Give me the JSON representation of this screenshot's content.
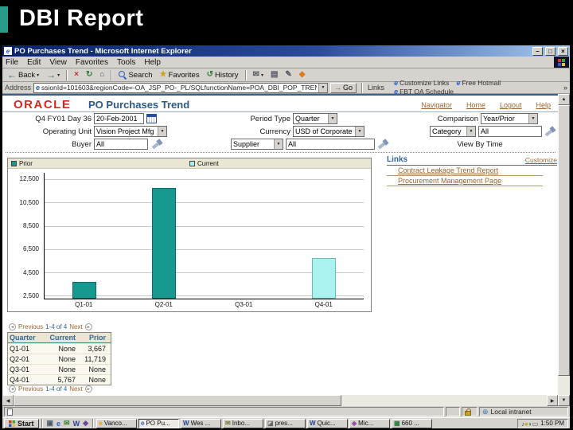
{
  "slide": {
    "title": "DBI Report",
    "accent_color": "#2a9a8a"
  },
  "browser": {
    "title": "PO Purchases Trend - Microsoft Internet Explorer",
    "menu_items": [
      "File",
      "Edit",
      "View",
      "Favorites",
      "Tools",
      "Help"
    ],
    "toolbar": {
      "back": "Back",
      "search": "Search",
      "favorites": "Favorites",
      "history": "History"
    },
    "address": {
      "label": "Address",
      "url": "ssionId=101603&regionCode=-OA_JSP_PO-_PL/SQLfunctionName=POA_DBI_POP_TREND_RP",
      "go": "Go"
    },
    "links_bar": {
      "label": "Links",
      "items": [
        "Customize Links",
        "Free Hotmail",
        "FBT QA Schedule"
      ],
      "overflow": "»"
    }
  },
  "page": {
    "brand": "ORACLE",
    "title": "PO Purchases Trend",
    "nav_links": [
      "Navigator",
      "Home",
      "Logout",
      "Help"
    ],
    "filters": {
      "date_label": "Q4 FY01 Day 36",
      "date_value": "20-Feb-2001",
      "period_type_label": "Period Type",
      "period_type_value": "Quarter",
      "comparison_label": "Comparison",
      "comparison_value": "Year/Prior",
      "operating_unit_label": "Operating Unit",
      "operating_unit_value": "Vision Project Mfg",
      "currency_label": "Currency",
      "currency_value": "USD of Corporate",
      "category_label": "Category",
      "category_value": "All",
      "buyer_label": "Buyer",
      "buyer_value": "All",
      "supplier_label": "Supplier",
      "supplier_value": "All",
      "view_by": "View By Time"
    },
    "links_panel": {
      "heading": "Links",
      "customize": "Customize",
      "items": [
        "Contract Leakage Trend Report",
        "Procurement Management Page"
      ]
    }
  },
  "chart_data": {
    "type": "bar",
    "title": "PO Purchases Trend",
    "categories": [
      "Q1-01",
      "Q2-01",
      "Q3-01",
      "Q4-01"
    ],
    "series": [
      {
        "name": "Prior",
        "color": "#18998f",
        "border": "#0c6b64",
        "values": [
          3667,
          11719,
          null,
          null
        ]
      },
      {
        "name": "Current",
        "color": "#aaf2ef",
        "border": "#6fb8b4",
        "values": [
          null,
          null,
          null,
          5767
        ]
      }
    ],
    "y_ticks": [
      "12,500",
      "10,500",
      "8,500",
      "6,500",
      "4,500",
      "2,500"
    ],
    "ylim": [
      2250,
      13050
    ],
    "grid": true,
    "legend_position": "top"
  },
  "table": {
    "pagination": {
      "previous": "Previous",
      "range": "1-4 of 4",
      "next": "Next"
    },
    "headers": [
      "Quarter",
      "Current",
      "Prior"
    ],
    "rows": [
      [
        "Q1-01",
        "None",
        "3,667"
      ],
      [
        "Q2-01",
        "None",
        "11,719"
      ],
      [
        "Q3-01",
        "None",
        "None"
      ],
      [
        "Q4-01",
        "5,767",
        "None"
      ]
    ]
  },
  "status_bar": {
    "zone": "Local intranet"
  },
  "taskbar": {
    "start": "Start",
    "quick_launch": [
      {
        "icon": "▣",
        "color": "#4a5a6a",
        "name": "show-desktop-icon"
      },
      {
        "icon": "e",
        "color": "#2b5fc7",
        "name": "ie-icon"
      },
      {
        "icon": "✉",
        "color": "#3a7d3a",
        "name": "mail-icon"
      },
      {
        "icon": "W",
        "color": "#23408f",
        "name": "word-icon"
      },
      {
        "icon": "◆",
        "color": "#6a4a9a",
        "name": "app-icon"
      }
    ],
    "buttons": [
      {
        "icon": "■",
        "icon_color": "#e0b23c",
        "label": "Vanco...",
        "active": false
      },
      {
        "icon": "e",
        "icon_color": "#2b5fc7",
        "label": "PO Pu...",
        "active": true
      },
      {
        "icon": "W",
        "icon_color": "#23408f",
        "label": "Wes ...",
        "active": false
      },
      {
        "icon": "✉",
        "icon_color": "#7a7a3a",
        "label": "Inbo...",
        "active": false
      },
      {
        "icon": "◪",
        "icon_color": "#666666",
        "label": "pres...",
        "active": false
      },
      {
        "icon": "W",
        "icon_color": "#23408f",
        "label": "Quic...",
        "active": false
      },
      {
        "icon": "◆",
        "icon_color": "#a04ab0",
        "label": "Mic...",
        "active": false
      },
      {
        "icon": "▦",
        "icon_color": "#2d7d3a",
        "label": "660 ...",
        "active": false
      }
    ],
    "tray_icons": [
      {
        "icon": "♪",
        "color": "#444444"
      },
      {
        "icon": "●",
        "color": "#c9a227"
      },
      {
        "icon": "◗",
        "color": "#3a7d3a"
      },
      {
        "icon": "▭",
        "color": "#444444"
      }
    ],
    "clock": "1:50 PM"
  }
}
